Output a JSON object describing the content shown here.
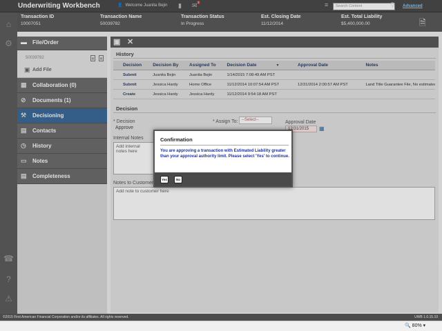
{
  "app": {
    "title": "Underwriting Workbench",
    "welcome": "Welcome Juanita Bejin",
    "notif_count": "3",
    "search_placeholder": "Search Content",
    "advanced": "Advanced"
  },
  "summary": {
    "headers": [
      "Transaction ID",
      "Transaction Name",
      "Transaction Status",
      "Est. Closing Date",
      "Est. Total Liability"
    ],
    "values": [
      "10007051",
      "50039782",
      "In Progress",
      "11/12/2014",
      "$5,400,000.00"
    ]
  },
  "nav": {
    "file_order": "File/Order",
    "file_id": "50039782",
    "add_file": "Add File",
    "items": [
      "Collaboration (0)",
      "Documents (1)",
      "Decisioning",
      "Contacts",
      "History",
      "Notes",
      "Completeness"
    ],
    "active": "Decisioning"
  },
  "history": {
    "title": "History",
    "columns": [
      "Decision",
      "Decision By",
      "Assigned To",
      "Decision Date",
      "Approval Date",
      "Notes"
    ],
    "rows": [
      [
        "Submit",
        "Juanita Bejin",
        "Juanita Bejin",
        "1/14/2015 7:08:49 AM PST",
        "",
        ""
      ],
      [
        "Submit",
        "Jessica Hardy",
        "Home Office",
        "11/12/2014 10:07:54 AM PST",
        "12/31/2014 2:00:57 AM PST",
        "Land Title Guarantee File, No estimated ..."
      ],
      [
        "Create",
        "Jessica Hardy",
        "Jessica Hardy",
        "11/12/2014 9:54:18 AM PST",
        "",
        ""
      ]
    ]
  },
  "decision": {
    "title": "Decision",
    "decision_label": "Decision",
    "decision_value": "Approve",
    "assign_label": "Assign To:",
    "assign_value": "--Select--",
    "approval_label": "Approval Date",
    "approval_value": "12/31/2015",
    "internal_label": "Internal Notes",
    "internal_placeholder": "Add internal notes here",
    "customer_label": "Notes to Customer",
    "customer_placeholder": "Add note to customer here"
  },
  "dialog": {
    "title": "Confirmation",
    "message": "You are approving a transaction with Estimated Liability greater than your approval authority limit. Please select 'Yes' to continue.",
    "yes": "Yes",
    "no": "No"
  },
  "footer": {
    "copyright": "©2015 First American Financial Corporation and/or its affiliates. All rights reserved.",
    "version": "UWB 1.0.15.10"
  },
  "statusbar": {
    "zoom": "80%"
  },
  "colors": {
    "accent": "#3c6a9a",
    "link": "#2d3f66",
    "dialog_text": "#1b33a8"
  }
}
